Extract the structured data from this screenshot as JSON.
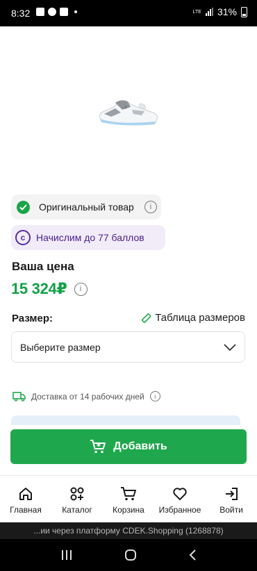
{
  "status_bar": {
    "time": "8:32",
    "network": "LTE",
    "battery": "31%"
  },
  "product": {
    "badge_original": "Оригинальный товар",
    "badge_points": "Начислим до 77 баллов",
    "points_icon_letter": "c"
  },
  "price": {
    "label": "Ваша цена",
    "value": "15 324₽"
  },
  "size": {
    "label": "Размер:",
    "table_link": "Таблица размеров",
    "select_placeholder": "Выберите размер"
  },
  "delivery": {
    "text": "Доставка от 14 рабочих дней"
  },
  "add_button": {
    "label": "Добавить"
  },
  "bottom_nav": {
    "items": [
      {
        "label": "Главная",
        "icon": "home-icon"
      },
      {
        "label": "Каталог",
        "icon": "catalog-icon"
      },
      {
        "label": "Корзина",
        "icon": "cart-icon"
      },
      {
        "label": "Избранное",
        "icon": "heart-icon"
      },
      {
        "label": "Войти",
        "icon": "login-icon"
      }
    ]
  },
  "footer_banner": {
    "text": "...ии через платформу CDEK.Shopping (1268878)"
  },
  "colors": {
    "accent_green": "#1fa74d",
    "price_green": "#12a146",
    "points_purple": "#5a2ca0"
  }
}
